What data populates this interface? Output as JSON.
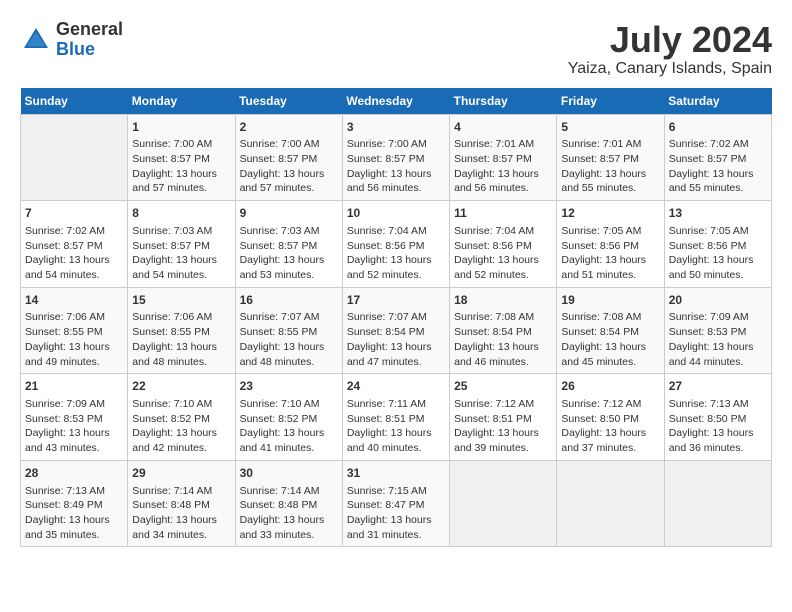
{
  "header": {
    "logo_line1": "General",
    "logo_line2": "Blue",
    "title": "July 2024",
    "subtitle": "Yaiza, Canary Islands, Spain"
  },
  "weekdays": [
    "Sunday",
    "Monday",
    "Tuesday",
    "Wednesday",
    "Thursday",
    "Friday",
    "Saturday"
  ],
  "weeks": [
    [
      {
        "day": "",
        "info": ""
      },
      {
        "day": "1",
        "info": "Sunrise: 7:00 AM\nSunset: 8:57 PM\nDaylight: 13 hours\nand 57 minutes."
      },
      {
        "day": "2",
        "info": "Sunrise: 7:00 AM\nSunset: 8:57 PM\nDaylight: 13 hours\nand 57 minutes."
      },
      {
        "day": "3",
        "info": "Sunrise: 7:00 AM\nSunset: 8:57 PM\nDaylight: 13 hours\nand 56 minutes."
      },
      {
        "day": "4",
        "info": "Sunrise: 7:01 AM\nSunset: 8:57 PM\nDaylight: 13 hours\nand 56 minutes."
      },
      {
        "day": "5",
        "info": "Sunrise: 7:01 AM\nSunset: 8:57 PM\nDaylight: 13 hours\nand 55 minutes."
      },
      {
        "day": "6",
        "info": "Sunrise: 7:02 AM\nSunset: 8:57 PM\nDaylight: 13 hours\nand 55 minutes."
      }
    ],
    [
      {
        "day": "7",
        "info": "Sunrise: 7:02 AM\nSunset: 8:57 PM\nDaylight: 13 hours\nand 54 minutes."
      },
      {
        "day": "8",
        "info": "Sunrise: 7:03 AM\nSunset: 8:57 PM\nDaylight: 13 hours\nand 54 minutes."
      },
      {
        "day": "9",
        "info": "Sunrise: 7:03 AM\nSunset: 8:57 PM\nDaylight: 13 hours\nand 53 minutes."
      },
      {
        "day": "10",
        "info": "Sunrise: 7:04 AM\nSunset: 8:56 PM\nDaylight: 13 hours\nand 52 minutes."
      },
      {
        "day": "11",
        "info": "Sunrise: 7:04 AM\nSunset: 8:56 PM\nDaylight: 13 hours\nand 52 minutes."
      },
      {
        "day": "12",
        "info": "Sunrise: 7:05 AM\nSunset: 8:56 PM\nDaylight: 13 hours\nand 51 minutes."
      },
      {
        "day": "13",
        "info": "Sunrise: 7:05 AM\nSunset: 8:56 PM\nDaylight: 13 hours\nand 50 minutes."
      }
    ],
    [
      {
        "day": "14",
        "info": "Sunrise: 7:06 AM\nSunset: 8:55 PM\nDaylight: 13 hours\nand 49 minutes."
      },
      {
        "day": "15",
        "info": "Sunrise: 7:06 AM\nSunset: 8:55 PM\nDaylight: 13 hours\nand 48 minutes."
      },
      {
        "day": "16",
        "info": "Sunrise: 7:07 AM\nSunset: 8:55 PM\nDaylight: 13 hours\nand 48 minutes."
      },
      {
        "day": "17",
        "info": "Sunrise: 7:07 AM\nSunset: 8:54 PM\nDaylight: 13 hours\nand 47 minutes."
      },
      {
        "day": "18",
        "info": "Sunrise: 7:08 AM\nSunset: 8:54 PM\nDaylight: 13 hours\nand 46 minutes."
      },
      {
        "day": "19",
        "info": "Sunrise: 7:08 AM\nSunset: 8:54 PM\nDaylight: 13 hours\nand 45 minutes."
      },
      {
        "day": "20",
        "info": "Sunrise: 7:09 AM\nSunset: 8:53 PM\nDaylight: 13 hours\nand 44 minutes."
      }
    ],
    [
      {
        "day": "21",
        "info": "Sunrise: 7:09 AM\nSunset: 8:53 PM\nDaylight: 13 hours\nand 43 minutes."
      },
      {
        "day": "22",
        "info": "Sunrise: 7:10 AM\nSunset: 8:52 PM\nDaylight: 13 hours\nand 42 minutes."
      },
      {
        "day": "23",
        "info": "Sunrise: 7:10 AM\nSunset: 8:52 PM\nDaylight: 13 hours\nand 41 minutes."
      },
      {
        "day": "24",
        "info": "Sunrise: 7:11 AM\nSunset: 8:51 PM\nDaylight: 13 hours\nand 40 minutes."
      },
      {
        "day": "25",
        "info": "Sunrise: 7:12 AM\nSunset: 8:51 PM\nDaylight: 13 hours\nand 39 minutes."
      },
      {
        "day": "26",
        "info": "Sunrise: 7:12 AM\nSunset: 8:50 PM\nDaylight: 13 hours\nand 37 minutes."
      },
      {
        "day": "27",
        "info": "Sunrise: 7:13 AM\nSunset: 8:50 PM\nDaylight: 13 hours\nand 36 minutes."
      }
    ],
    [
      {
        "day": "28",
        "info": "Sunrise: 7:13 AM\nSunset: 8:49 PM\nDaylight: 13 hours\nand 35 minutes."
      },
      {
        "day": "29",
        "info": "Sunrise: 7:14 AM\nSunset: 8:48 PM\nDaylight: 13 hours\nand 34 minutes."
      },
      {
        "day": "30",
        "info": "Sunrise: 7:14 AM\nSunset: 8:48 PM\nDaylight: 13 hours\nand 33 minutes."
      },
      {
        "day": "31",
        "info": "Sunrise: 7:15 AM\nSunset: 8:47 PM\nDaylight: 13 hours\nand 31 minutes."
      },
      {
        "day": "",
        "info": ""
      },
      {
        "day": "",
        "info": ""
      },
      {
        "day": "",
        "info": ""
      }
    ]
  ]
}
